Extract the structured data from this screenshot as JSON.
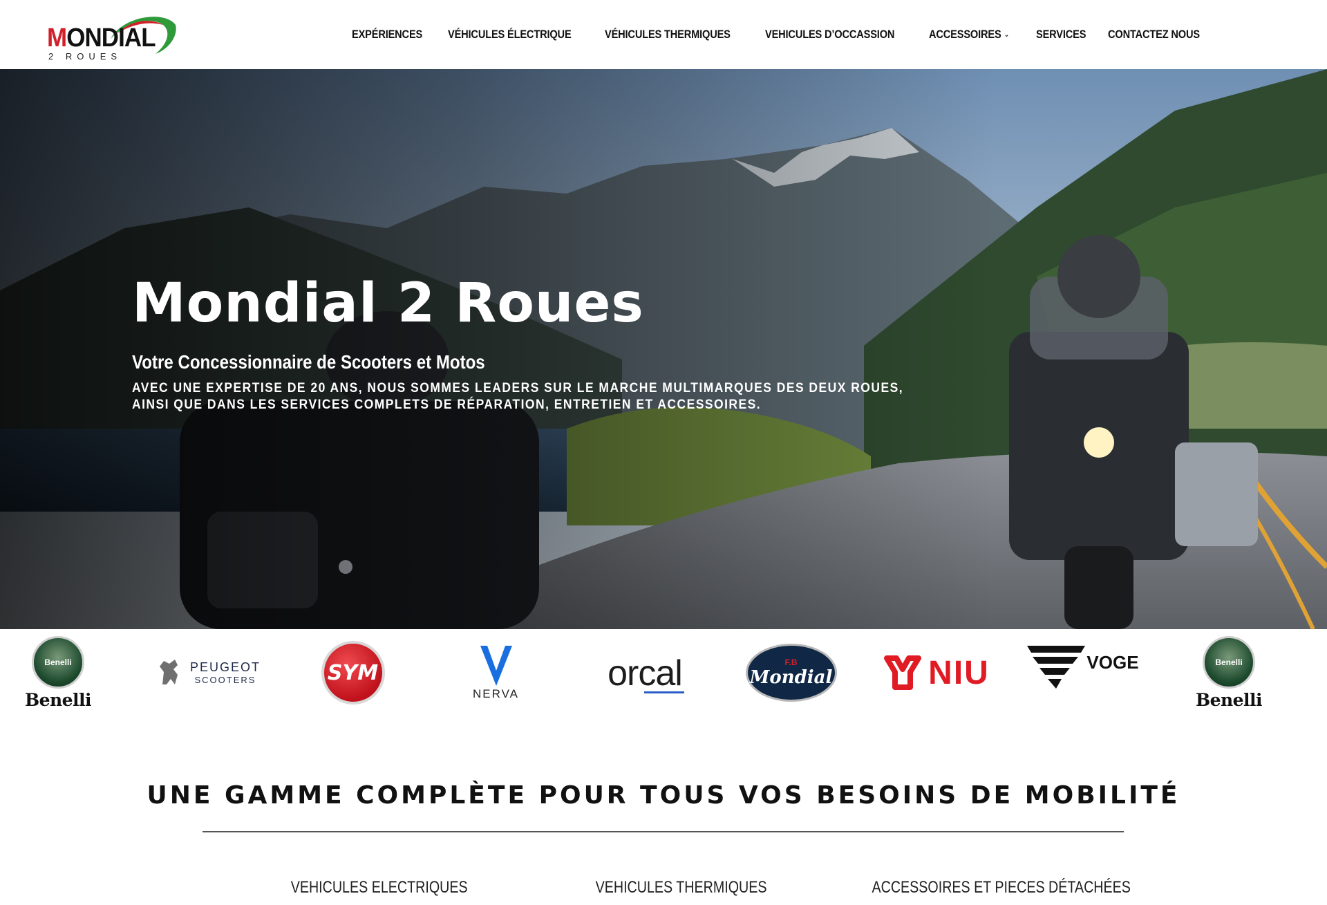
{
  "brand": {
    "logo_word": "MONDIAL",
    "logo_sub": "2 ROUES"
  },
  "nav": {
    "items": [
      {
        "label": "EXPÉRIENCES"
      },
      {
        "label": "VÉHICULES ÉLECTRIQUE"
      },
      {
        "label": "VÉHICULES THERMIQUES"
      },
      {
        "label": "VEHICULES D’OCCASSION"
      },
      {
        "label": "ACCESSOIRES",
        "has_dropdown": true
      },
      {
        "label": "SERVICES"
      },
      {
        "label": "CONTACTEZ NOUS"
      }
    ]
  },
  "hero": {
    "title": "Mondial 2 Roues",
    "subtitle": "Votre Concessionnaire de Scooters et Motos",
    "description_line1": "AVEC UNE EXPERTISE DE 20 ANS, NOUS SOMMES LEADERS SUR LE MARCHE MULTIMARQUES DES DEUX ROUES,",
    "description_line2": "AINSI QUE DANS LES SERVICES COMPLETS DE RÉPARATION, ENTRETIEN ET ACCESSOIRES."
  },
  "brands": {
    "benelli": "Benelli",
    "peugeot": "PEUGEOT",
    "peugeot_sub": "SCOOTERS",
    "sym": "SYM",
    "nerva": "NERVA",
    "orcal": "orcal",
    "mondial": "Mondial",
    "mondial_initials": "F.B",
    "niu": "NIU",
    "voge": "VOGE"
  },
  "section": {
    "title": "UNE GAMME COMPLÈTE POUR TOUS VOS BESOINS DE MOBILITÉ",
    "categories": [
      {
        "label": "VEHICULES ELECTRIQUES"
      },
      {
        "label": "VEHICULES THERMIQUES"
      },
      {
        "label": "ACCESSOIRES ET PIECES DÉTACHÉES"
      }
    ]
  },
  "colors": {
    "brand_red": "#d2202a",
    "brand_green": "#2f9a3a",
    "niu_red": "#e01b24",
    "text": "#111111"
  }
}
